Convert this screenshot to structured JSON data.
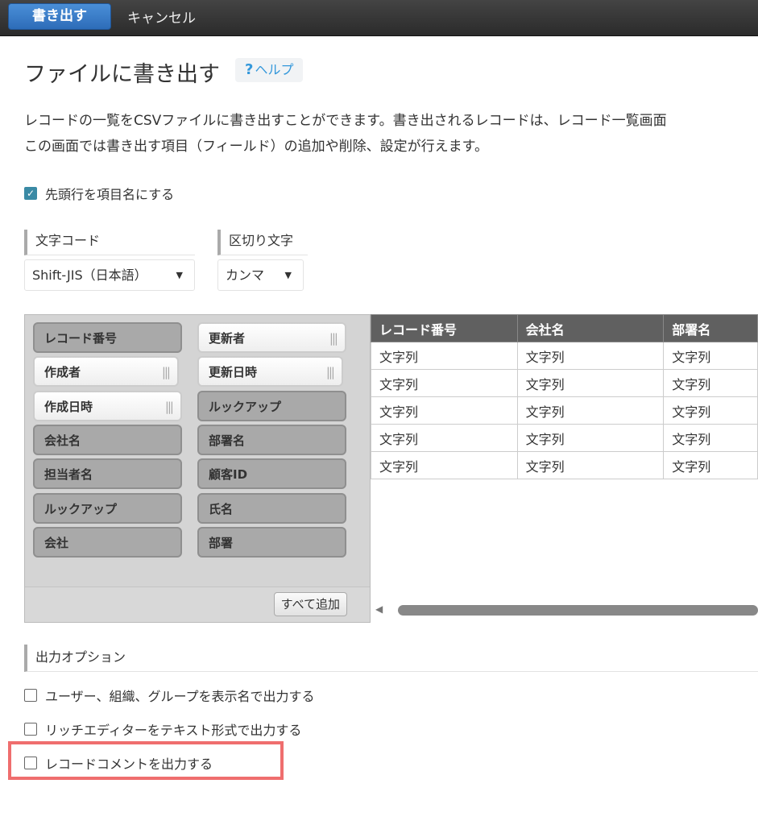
{
  "toolbar": {
    "export": "書き出す",
    "cancel": "キャンセル"
  },
  "title": "ファイルに書き出す",
  "help": {
    "icon": "?",
    "label": "ヘルプ"
  },
  "description": [
    "レコードの一覧をCSVファイルに書き出すことができます。書き出されるレコードは、レコード一覧画面",
    "この画面では書き出す項目（フィールド）の追加や削除、設定が行えます。"
  ],
  "header_row_checkbox": {
    "label": "先頭行を項目名にする",
    "checked": true
  },
  "encoding": {
    "label": "文字コード",
    "value": "Shift-JIS（日本語）"
  },
  "delimiter": {
    "label": "区切り文字",
    "value": "カンマ"
  },
  "fields_left": [
    {
      "label": "レコード番号",
      "added": true
    },
    {
      "label": "作成者",
      "added": false
    },
    {
      "label": "作成日時",
      "added": false
    },
    {
      "label": "会社名",
      "added": true
    },
    {
      "label": "担当者名",
      "added": true
    },
    {
      "label": "ルックアップ",
      "added": true
    },
    {
      "label": "会社",
      "added": true
    }
  ],
  "fields_right": [
    {
      "label": "更新者",
      "added": false
    },
    {
      "label": "更新日時",
      "added": false
    },
    {
      "label": "ルックアップ",
      "added": true
    },
    {
      "label": "部署名",
      "added": true
    },
    {
      "label": "顧客ID",
      "added": true
    },
    {
      "label": "氏名",
      "added": true
    },
    {
      "label": "部署",
      "added": true
    }
  ],
  "add_all": "すべて追加",
  "table": {
    "headers": [
      "レコード番号",
      "会社名",
      "部署名"
    ],
    "rows": [
      [
        "文字列",
        "文字列",
        "文字列"
      ],
      [
        "文字列",
        "文字列",
        "文字列"
      ],
      [
        "文字列",
        "文字列",
        "文字列"
      ],
      [
        "文字列",
        "文字列",
        "文字列"
      ],
      [
        "文字列",
        "文字列",
        "文字列"
      ]
    ]
  },
  "options": {
    "label": "出力オプション",
    "items": [
      {
        "label": "ユーザー、組織、グループを表示名で出力する",
        "checked": false
      },
      {
        "label": "リッチエディターをテキスト形式で出力する",
        "checked": false
      },
      {
        "label": "レコードコメントを出力する",
        "checked": false
      }
    ]
  }
}
